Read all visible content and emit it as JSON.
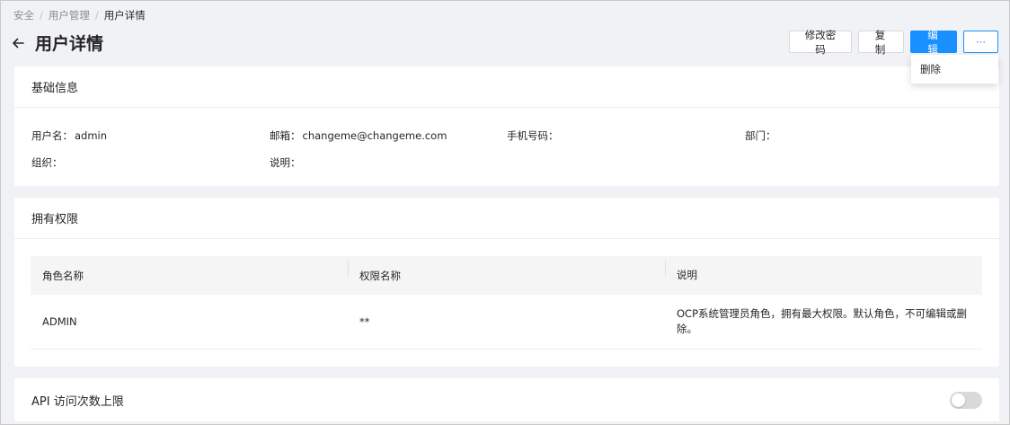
{
  "breadcrumb": [
    "安全",
    "用户管理",
    "用户详情"
  ],
  "page": {
    "title": "用户详情"
  },
  "actions": {
    "change_password": "修改密码",
    "copy": "复制",
    "edit": "编辑",
    "more": "···"
  },
  "more_menu": {
    "delete": "删除"
  },
  "basic_info": {
    "title": "基础信息",
    "fields": [
      {
        "label": "用户名：",
        "value": "admin"
      },
      {
        "label": "邮箱：",
        "value": "changeme@changeme.com"
      },
      {
        "label": "手机号码：",
        "value": ""
      },
      {
        "label": "部门：",
        "value": ""
      },
      {
        "label": "组织：",
        "value": ""
      },
      {
        "label": "说明：",
        "value": ""
      }
    ]
  },
  "permissions": {
    "title": "拥有权限",
    "columns": [
      "角色名称",
      "权限名称",
      "说明"
    ],
    "rows": [
      {
        "role": "ADMIN",
        "permission": "**",
        "description": "OCP系统管理员角色，拥有最大权限。默认角色，不可编辑或删除。"
      }
    ]
  },
  "api_limit": {
    "title": "API 访问次数上限",
    "enabled": false
  },
  "colors": {
    "primary": "#1890ff",
    "background": "#f0f2f5",
    "toggle_off": "#d9d9d9"
  }
}
